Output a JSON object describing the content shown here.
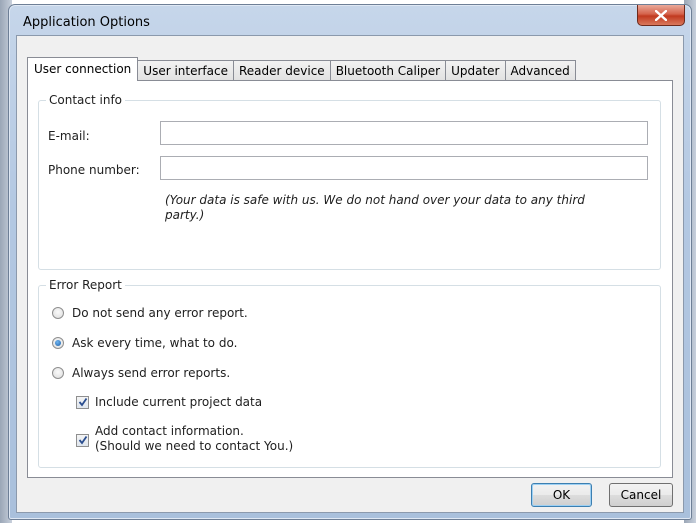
{
  "window": {
    "title": "Application Options"
  },
  "tabs": [
    {
      "label": "User connection",
      "active": true
    },
    {
      "label": "User interface"
    },
    {
      "label": "Reader device"
    },
    {
      "label": "Bluetooth Caliper"
    },
    {
      "label": "Updater"
    },
    {
      "label": "Advanced"
    }
  ],
  "contact": {
    "legend": "Contact info",
    "email_label": "E-mail:",
    "email_value": "",
    "phone_label": "Phone number:",
    "phone_value": "",
    "note_line1": "(Your data is safe with us. We do not hand over your data to any third",
    "note_line2": "party.)"
  },
  "error_report": {
    "legend": "Error Report",
    "options": [
      {
        "label": "Do not send any error report.",
        "checked": false
      },
      {
        "label": "Ask every time, what to do.",
        "checked": true
      },
      {
        "label": "Always send error reports.",
        "checked": false
      }
    ],
    "include_project": {
      "label": "Include current project data",
      "checked": true
    },
    "add_contact": {
      "line1": "Add contact information.",
      "line2": "(Should we need to contact You.)",
      "checked": true
    }
  },
  "buttons": {
    "ok": "OK",
    "cancel": "Cancel"
  },
  "colors": {
    "selected_accent": "#1d5fa8",
    "close_button": "#c13a20"
  }
}
